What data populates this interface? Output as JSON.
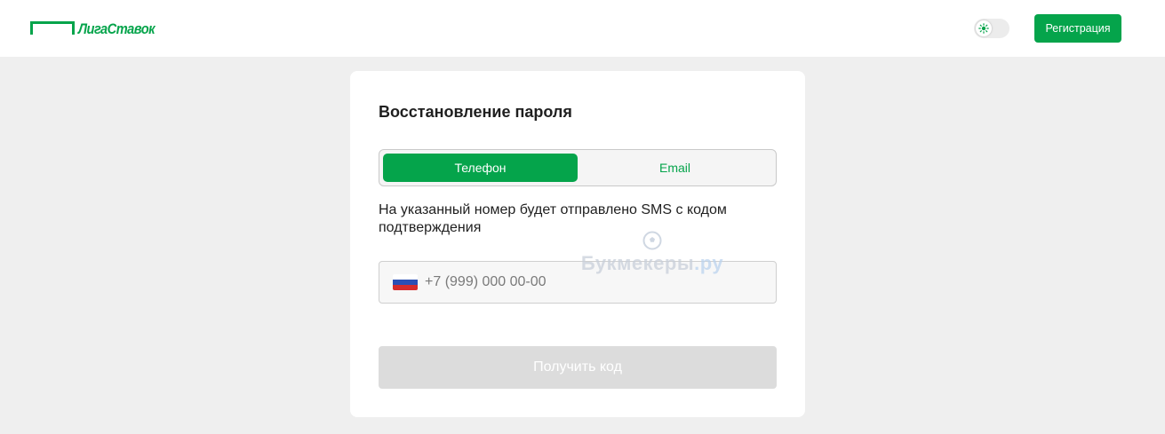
{
  "header": {
    "logo_text": "ЛигаСтавок",
    "register_label": "Регистрация",
    "theme_toggle_icon": "sun-icon"
  },
  "colors": {
    "brand": "#05a44b",
    "background": "#efefef",
    "disabled": "#dcdcdc"
  },
  "recovery": {
    "title": "Восстановление пароля",
    "tabs": [
      {
        "label": "Телефон",
        "active": true
      },
      {
        "label": "Email",
        "active": false
      }
    ],
    "info": "На указанный номер будет отправлено SMS с кодом подтверждения",
    "phone_placeholder": "+7 (999) 000 00-00",
    "country_flag_icon": "russia-flag-icon",
    "submit_label": "Получить код"
  },
  "watermark": {
    "text_main": "Букмекеры",
    "text_suffix": ".ру"
  }
}
